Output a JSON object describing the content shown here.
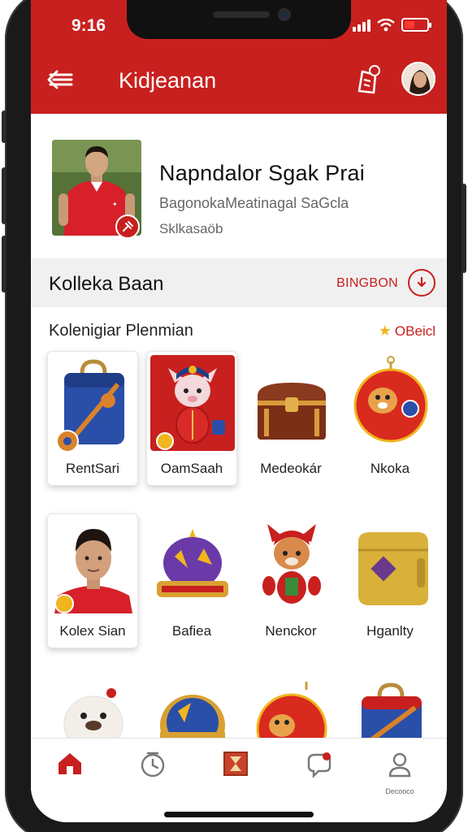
{
  "status": {
    "time": "9:16"
  },
  "header": {
    "title": "Kidjeanan",
    "back_icon": "back-arrow-icon",
    "notification_icon": "bell-icon"
  },
  "profile": {
    "name": "Napndalor Sgak Prai",
    "subtitle": "BagonokaMeatinagal SaGcla",
    "subtitle2": "Sklkasaöb"
  },
  "section": {
    "title": "Kolleka Baan",
    "link_label": "BINGBON"
  },
  "subsection": {
    "title": "Kolenigiar Plenmian",
    "badge": "OBeicl"
  },
  "grid": {
    "row1": [
      {
        "label": "RentSari"
      },
      {
        "label": "OamSaah"
      },
      {
        "label": "Medeokár"
      },
      {
        "label": "Nkoka"
      }
    ],
    "row2": [
      {
        "label": "Kolex Sian"
      },
      {
        "label": "Bafiea"
      },
      {
        "label": "Nenckor"
      },
      {
        "label": "Hganlty"
      }
    ]
  },
  "nav": {
    "items": [
      {
        "icon": "home-icon"
      },
      {
        "icon": "clock-icon"
      },
      {
        "icon": "hourglass-icon"
      },
      {
        "icon": "chat-icon"
      },
      {
        "icon": "profile-icon",
        "label": "Decooco"
      }
    ]
  },
  "colors": {
    "brand": "#c8201e",
    "background": "#ffffff",
    "section_bg": "#f0f0f0"
  }
}
